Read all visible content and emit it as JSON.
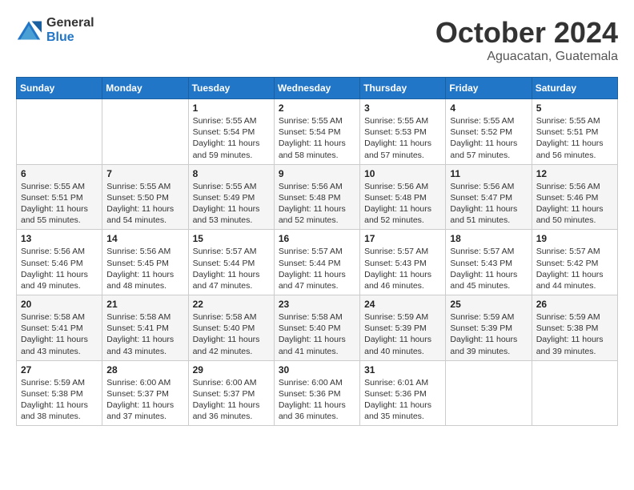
{
  "header": {
    "logo": {
      "text_general": "General",
      "text_blue": "Blue"
    },
    "title": "October 2024",
    "location": "Aguacatan, Guatemala"
  },
  "calendar": {
    "days_of_week": [
      "Sunday",
      "Monday",
      "Tuesday",
      "Wednesday",
      "Thursday",
      "Friday",
      "Saturday"
    ],
    "weeks": [
      [
        {
          "day": "",
          "info": ""
        },
        {
          "day": "",
          "info": ""
        },
        {
          "day": "1",
          "info": "Sunrise: 5:55 AM\nSunset: 5:54 PM\nDaylight: 11 hours and 59 minutes."
        },
        {
          "day": "2",
          "info": "Sunrise: 5:55 AM\nSunset: 5:54 PM\nDaylight: 11 hours and 58 minutes."
        },
        {
          "day": "3",
          "info": "Sunrise: 5:55 AM\nSunset: 5:53 PM\nDaylight: 11 hours and 57 minutes."
        },
        {
          "day": "4",
          "info": "Sunrise: 5:55 AM\nSunset: 5:52 PM\nDaylight: 11 hours and 57 minutes."
        },
        {
          "day": "5",
          "info": "Sunrise: 5:55 AM\nSunset: 5:51 PM\nDaylight: 11 hours and 56 minutes."
        }
      ],
      [
        {
          "day": "6",
          "info": "Sunrise: 5:55 AM\nSunset: 5:51 PM\nDaylight: 11 hours and 55 minutes."
        },
        {
          "day": "7",
          "info": "Sunrise: 5:55 AM\nSunset: 5:50 PM\nDaylight: 11 hours and 54 minutes."
        },
        {
          "day": "8",
          "info": "Sunrise: 5:55 AM\nSunset: 5:49 PM\nDaylight: 11 hours and 53 minutes."
        },
        {
          "day": "9",
          "info": "Sunrise: 5:56 AM\nSunset: 5:48 PM\nDaylight: 11 hours and 52 minutes."
        },
        {
          "day": "10",
          "info": "Sunrise: 5:56 AM\nSunset: 5:48 PM\nDaylight: 11 hours and 52 minutes."
        },
        {
          "day": "11",
          "info": "Sunrise: 5:56 AM\nSunset: 5:47 PM\nDaylight: 11 hours and 51 minutes."
        },
        {
          "day": "12",
          "info": "Sunrise: 5:56 AM\nSunset: 5:46 PM\nDaylight: 11 hours and 50 minutes."
        }
      ],
      [
        {
          "day": "13",
          "info": "Sunrise: 5:56 AM\nSunset: 5:46 PM\nDaylight: 11 hours and 49 minutes."
        },
        {
          "day": "14",
          "info": "Sunrise: 5:56 AM\nSunset: 5:45 PM\nDaylight: 11 hours and 48 minutes."
        },
        {
          "day": "15",
          "info": "Sunrise: 5:57 AM\nSunset: 5:44 PM\nDaylight: 11 hours and 47 minutes."
        },
        {
          "day": "16",
          "info": "Sunrise: 5:57 AM\nSunset: 5:44 PM\nDaylight: 11 hours and 47 minutes."
        },
        {
          "day": "17",
          "info": "Sunrise: 5:57 AM\nSunset: 5:43 PM\nDaylight: 11 hours and 46 minutes."
        },
        {
          "day": "18",
          "info": "Sunrise: 5:57 AM\nSunset: 5:43 PM\nDaylight: 11 hours and 45 minutes."
        },
        {
          "day": "19",
          "info": "Sunrise: 5:57 AM\nSunset: 5:42 PM\nDaylight: 11 hours and 44 minutes."
        }
      ],
      [
        {
          "day": "20",
          "info": "Sunrise: 5:58 AM\nSunset: 5:41 PM\nDaylight: 11 hours and 43 minutes."
        },
        {
          "day": "21",
          "info": "Sunrise: 5:58 AM\nSunset: 5:41 PM\nDaylight: 11 hours and 43 minutes."
        },
        {
          "day": "22",
          "info": "Sunrise: 5:58 AM\nSunset: 5:40 PM\nDaylight: 11 hours and 42 minutes."
        },
        {
          "day": "23",
          "info": "Sunrise: 5:58 AM\nSunset: 5:40 PM\nDaylight: 11 hours and 41 minutes."
        },
        {
          "day": "24",
          "info": "Sunrise: 5:59 AM\nSunset: 5:39 PM\nDaylight: 11 hours and 40 minutes."
        },
        {
          "day": "25",
          "info": "Sunrise: 5:59 AM\nSunset: 5:39 PM\nDaylight: 11 hours and 39 minutes."
        },
        {
          "day": "26",
          "info": "Sunrise: 5:59 AM\nSunset: 5:38 PM\nDaylight: 11 hours and 39 minutes."
        }
      ],
      [
        {
          "day": "27",
          "info": "Sunrise: 5:59 AM\nSunset: 5:38 PM\nDaylight: 11 hours and 38 minutes."
        },
        {
          "day": "28",
          "info": "Sunrise: 6:00 AM\nSunset: 5:37 PM\nDaylight: 11 hours and 37 minutes."
        },
        {
          "day": "29",
          "info": "Sunrise: 6:00 AM\nSunset: 5:37 PM\nDaylight: 11 hours and 36 minutes."
        },
        {
          "day": "30",
          "info": "Sunrise: 6:00 AM\nSunset: 5:36 PM\nDaylight: 11 hours and 36 minutes."
        },
        {
          "day": "31",
          "info": "Sunrise: 6:01 AM\nSunset: 5:36 PM\nDaylight: 11 hours and 35 minutes."
        },
        {
          "day": "",
          "info": ""
        },
        {
          "day": "",
          "info": ""
        }
      ]
    ]
  }
}
